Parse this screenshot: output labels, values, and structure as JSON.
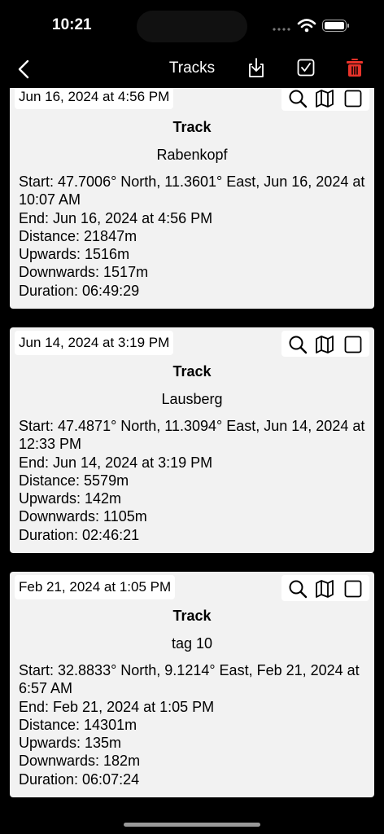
{
  "status_bar": {
    "time": "10:21"
  },
  "nav": {
    "title": "Tracks"
  },
  "colors": {
    "accent_red": "#e8332a",
    "card_bg": "#f2f2f2"
  },
  "icons": {
    "nav": [
      "chevron-left-icon",
      "export-icon",
      "checkmark-square-icon",
      "trash-icon"
    ],
    "card_actions": [
      "search-icon",
      "map-icon",
      "checkbox-icon"
    ]
  },
  "tracks": [
    {
      "date": "Jun 16, 2024 at 4:56 PM",
      "kind": "Track",
      "name": "Rabenkopf",
      "start": "Start: 47.7006° North, 11.3601° East, Jun 16, 2024 at 10:07 AM",
      "end": "End: Jun 16, 2024 at 4:56 PM",
      "distance": "Distance: 21847m",
      "upwards": "Upwards: 1516m",
      "downwards": "Downwards: 1517m",
      "duration": "Duration: 06:49:29"
    },
    {
      "date": "Jun 14, 2024 at 3:19 PM",
      "kind": "Track",
      "name": "Lausberg",
      "start": "Start: 47.4871° North, 11.3094° East, Jun 14, 2024 at 12:33 PM",
      "end": "End: Jun 14, 2024 at 3:19 PM",
      "distance": "Distance: 5579m",
      "upwards": "Upwards: 142m",
      "downwards": "Downwards: 1105m",
      "duration": "Duration: 02:46:21"
    },
    {
      "date": "Feb 21, 2024 at 1:05 PM",
      "kind": "Track",
      "name": "tag 10",
      "start": "Start: 32.8833° North, 9.1214° East, Feb 21, 2024 at 6:57 AM",
      "end": "End: Feb 21, 2024 at 1:05 PM",
      "distance": "Distance: 14301m",
      "upwards": "Upwards: 135m",
      "downwards": "Downwards: 182m",
      "duration": "Duration: 06:07:24"
    }
  ]
}
